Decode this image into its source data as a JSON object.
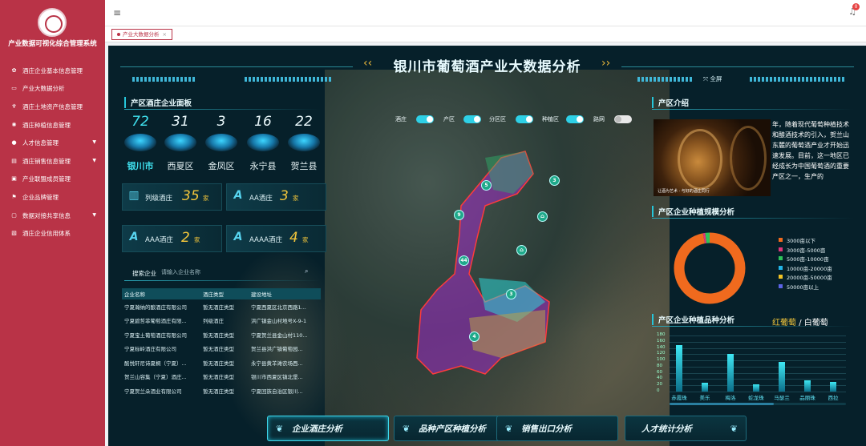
{
  "sidebar": {
    "system_title": "产业数据可视化综合管理系统",
    "items": [
      {
        "label": "酒庄企业基本信息管理",
        "icon": "gear-icon",
        "has_children": false
      },
      {
        "label": "产业大数据分析",
        "icon": "monitor-icon",
        "has_children": false
      },
      {
        "label": "酒庄土地资产信息管理",
        "icon": "trophy-icon",
        "has_children": false
      },
      {
        "label": "酒庄种植信息管理",
        "icon": "sun-icon",
        "has_children": false
      },
      {
        "label": "人才信息管理",
        "icon": "user-icon",
        "has_children": true
      },
      {
        "label": "酒庄销售信息管理",
        "icon": "database-icon",
        "has_children": true
      },
      {
        "label": "产业联盟成员管理",
        "icon": "printer-icon",
        "has_children": false
      },
      {
        "label": "企业品牌管理",
        "icon": "flag-icon",
        "has_children": false
      },
      {
        "label": "数据对接共享信息",
        "icon": "folder-icon",
        "has_children": true
      },
      {
        "label": "酒庄企业信用体系",
        "icon": "document-icon",
        "has_children": false
      }
    ]
  },
  "topbar": {
    "notification_count": "0"
  },
  "tabs": [
    {
      "label": "产业大数据分析",
      "close": "×"
    }
  ],
  "dashboard": {
    "title": "银川市葡萄酒产业大数据分析",
    "fullscreen_label": "全屏",
    "left_panel": {
      "title": "产区酒庄企业面板",
      "regions": [
        {
          "name": "银川市",
          "count": "72"
        },
        {
          "name": "西夏区",
          "count": "31"
        },
        {
          "name": "金凤区",
          "count": "3"
        },
        {
          "name": "永宁县",
          "count": "16"
        },
        {
          "name": "贺兰县",
          "count": "22"
        }
      ],
      "levels": [
        {
          "icon": "▥",
          "name": "列级酒庄",
          "value": "35",
          "unit": "家"
        },
        {
          "icon": "A",
          "name": "AA酒庄",
          "value": "3",
          "unit": "家"
        },
        {
          "icon": "A",
          "name": "AAA酒庄",
          "value": "2",
          "unit": "家"
        },
        {
          "icon": "A",
          "name": "AAAA酒庄",
          "value": "4",
          "unit": "家"
        }
      ],
      "search_label": "搜索企业",
      "search_placeholder": "请输入企业名称",
      "table_headers": [
        "企业名称",
        "酒庄类型",
        "建设地址"
      ],
      "table_rows": [
        [
          "宁夏瀚纳的酿酒庄有限公司",
          "暂无酒庄类型",
          "宁夏西夏区北京西路1..."
        ],
        [
          "宁夏碧哲菲葡萄酒庄有限...",
          "列级酒庄",
          "洪广镇金山村地号X-9-1"
        ],
        [
          "宁夏宝土葡萄酒庄有限公司",
          "暂无酒庄类型",
          "宁夏贺兰县金山村110..."
        ],
        [
          "宁夏标岭酒庄有限公司",
          "暂无酒庄类型",
          "贺兰县洪广镇葡萄园..."
        ],
        [
          "酩悦轩尼诗夏桐（宁夏）...",
          "暂无酒庄类型",
          "永宁县黄羊滩农场西..."
        ],
        [
          "贺兰山容集（宁夏）酒庄...",
          "暂无酒庄类型",
          "银川市西夏区镇北堡..."
        ],
        [
          "宁夏贺兰朵酒业有限公司",
          "暂无酒庄类型",
          "宁夏回族自治区银川..."
        ]
      ]
    },
    "map_toggles": [
      {
        "label": "酒庄",
        "on": true
      },
      {
        "label": "产区",
        "on": true
      },
      {
        "label": "分区区",
        "on": true
      },
      {
        "label": "种植区",
        "on": true
      },
      {
        "label": "路网",
        "on": false
      }
    ],
    "map_pins": [
      "5",
      "3",
      "9",
      "44",
      "3",
      "4"
    ],
    "intro": {
      "title": "产区介绍",
      "caption": "让酒为艺术 · 与好的酒庄同行",
      "text": "年，随着现代葡萄种植技术和酿酒技术的引入，贺兰山东麓的葡萄酒产业才开始迅速发展。目前，这一地区已经成长为中国葡萄酒的重要产区之一，生产的"
    },
    "scale_panel": {
      "title": "产区企业种植规模分析",
      "legend": [
        {
          "label": "3000亩以下",
          "color": "#f06a1e"
        },
        {
          "label": "3000亩-5000亩",
          "color": "#e0357a"
        },
        {
          "label": "5000亩-10000亩",
          "color": "#2fc35a"
        },
        {
          "label": "10000亩-20000亩",
          "color": "#22b5e8"
        },
        {
          "label": "20000亩-50000亩",
          "color": "#f2c223"
        },
        {
          "label": "50000亩以上",
          "color": "#5b63e6"
        }
      ]
    },
    "variety_panel": {
      "title": "产区企业种植品种分析",
      "tab_active": "红葡萄",
      "tab_sep": "/",
      "tab_other": "白葡萄"
    },
    "bottom_nav": [
      {
        "label": "企业酒庄分析",
        "active": true
      },
      {
        "label": "品种产区种植分析",
        "active": false
      },
      {
        "label": "销售出口分析",
        "active": false
      },
      {
        "label": "人才统计分析",
        "active": false
      }
    ]
  },
  "chart_data": [
    {
      "type": "pie",
      "title": "产区企业种植规模分析",
      "categories": [
        "3000亩以下",
        "3000亩-5000亩",
        "5000亩-10000亩",
        "10000亩-20000亩",
        "20000亩-50000亩",
        "50000亩以上"
      ],
      "values": [
        97,
        1,
        2,
        0,
        0,
        0
      ],
      "colors": [
        "#f06a1e",
        "#e0357a",
        "#2fc35a",
        "#22b5e8",
        "#f2c223",
        "#5b63e6"
      ]
    },
    {
      "type": "bar",
      "title": "产区企业种植品种分析",
      "categories": [
        "赤霞珠",
        "美乐",
        "梅洛",
        "蛇龙珠",
        "马瑟兰",
        "品丽珠",
        "西拉"
      ],
      "values": [
        148,
        28,
        122,
        22,
        95,
        35,
        30
      ],
      "ylim": [
        0,
        180
      ],
      "yticks": [
        "0",
        "20",
        "40",
        "60",
        "80",
        "100",
        "120",
        "140",
        "160",
        "180"
      ]
    }
  ]
}
